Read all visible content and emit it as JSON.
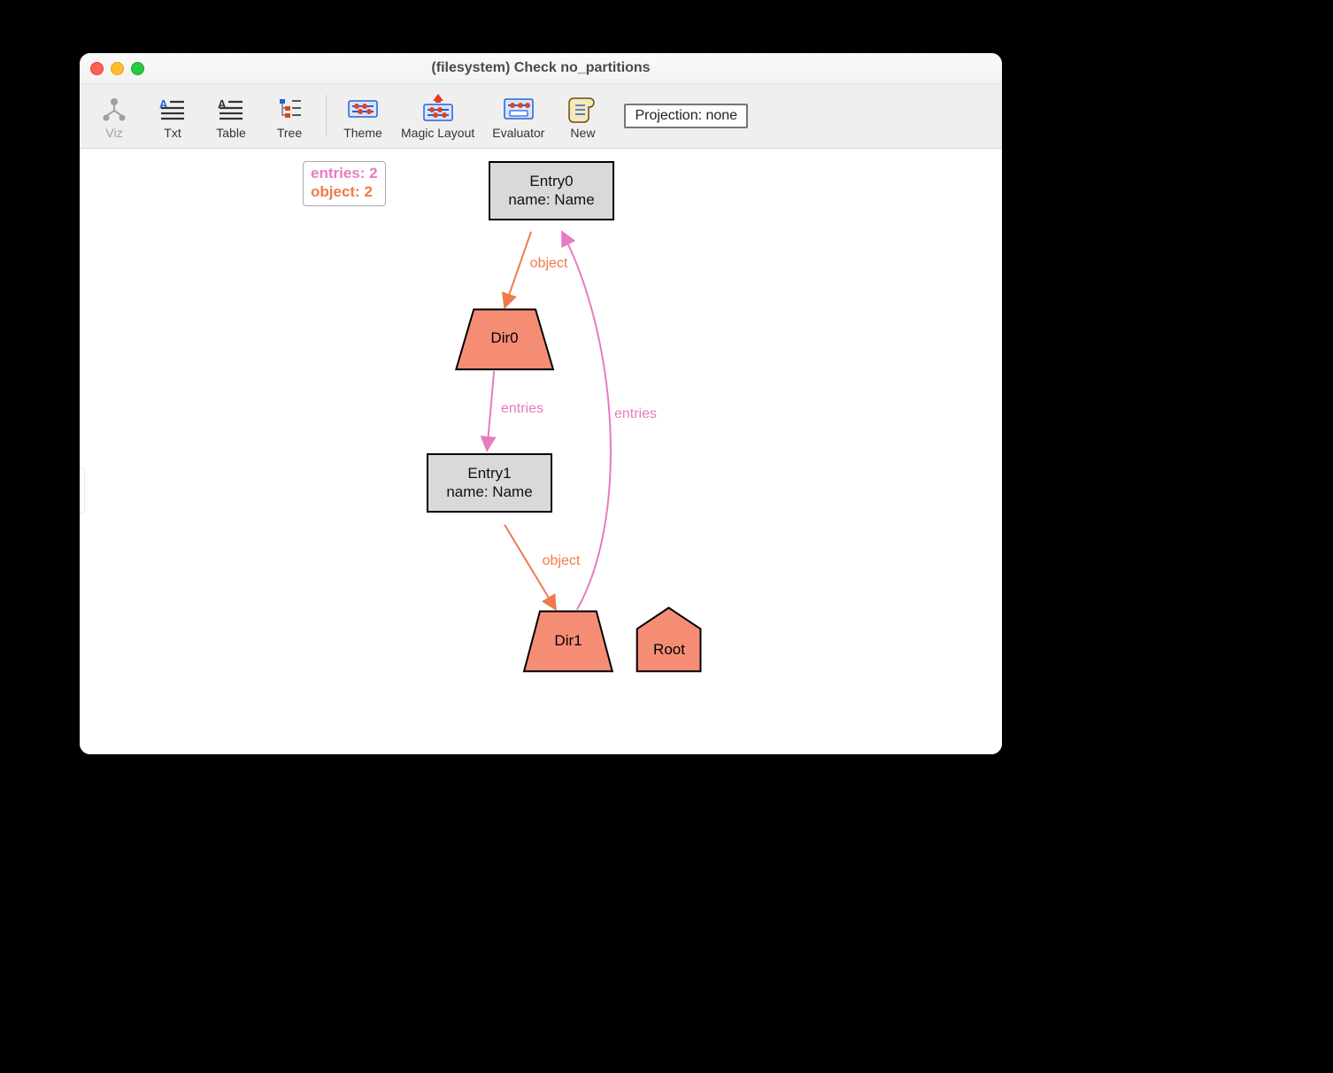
{
  "window": {
    "title": "(filesystem) Check no_partitions"
  },
  "toolbar": {
    "viz": "Viz",
    "txt": "Txt",
    "table": "Table",
    "tree": "Tree",
    "theme": "Theme",
    "magic": "Magic Layout",
    "evaluator": "Evaluator",
    "new": "New"
  },
  "projection": "Projection: none",
  "legend": {
    "line1": "entries: 2",
    "line2": "object: 2"
  },
  "nodes": {
    "entry0": {
      "line1": "Entry0",
      "line2": "name: Name"
    },
    "entry1": {
      "line1": "Entry1",
      "line2": "name: Name"
    },
    "dir0": {
      "label": "Dir0"
    },
    "dir1": {
      "label": "Dir1"
    },
    "root": {
      "label": "Root"
    }
  },
  "edges": {
    "e0_dir0": "object",
    "dir0_e1": "entries",
    "e1_dir1": "object",
    "dir1_e0": "entries"
  },
  "colors": {
    "salmon": "#f58d75",
    "salmonStroke": "#a84a34",
    "object": "#f07a4a",
    "entries": "#e77bc0"
  }
}
